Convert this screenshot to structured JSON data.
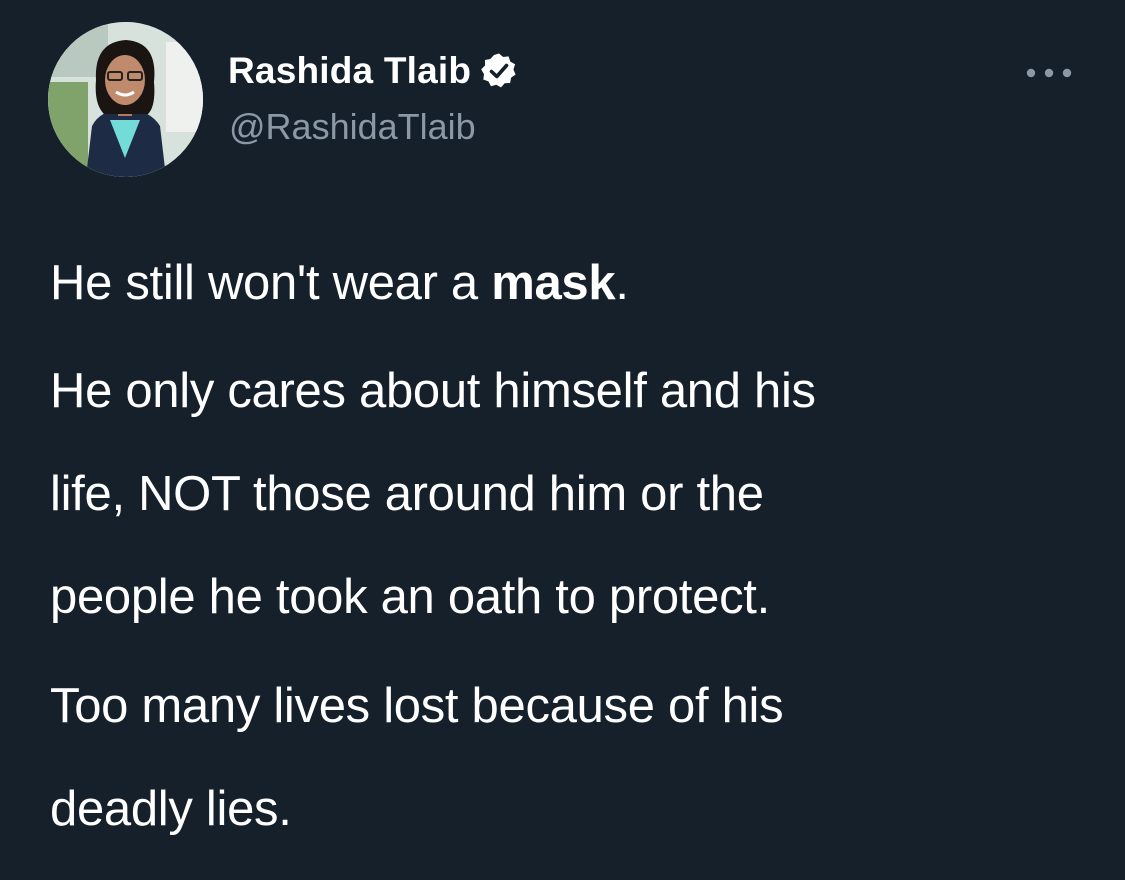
{
  "tweet": {
    "author": {
      "display_name": "Rashida Tlaib",
      "handle": "@RashidaTlaib",
      "verified_icon": "verified-badge-icon",
      "avatar": "profile-photo"
    },
    "more_icon": "more-options-icon",
    "paragraphs": [
      {
        "segments": [
          {
            "text": "He still won't wear a ",
            "bold": false
          },
          {
            "text": "mask",
            "bold": true
          },
          {
            "text": ".",
            "bold": false
          }
        ]
      },
      {
        "lines": [
          "He only cares about himself and his",
          "life, NOT those around him or the",
          "people he took an oath to protect."
        ]
      },
      {
        "lines": [
          "Too many lives lost because of his",
          "deadly lies."
        ]
      }
    ]
  },
  "colors": {
    "background": "#15202b",
    "text_primary": "#ffffff",
    "text_secondary": "#8b98a5"
  }
}
